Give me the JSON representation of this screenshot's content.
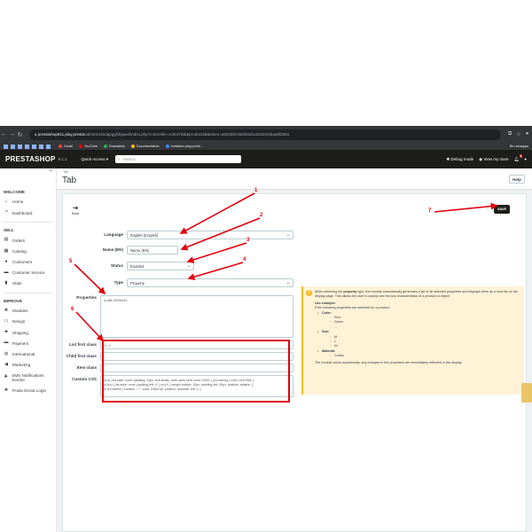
{
  "browser": {
    "url_host": "prestashop811.play.presta",
    "url_rest": "/admin140xdqpgyjhbjqwd/index.php?controller=AdminTab&productab&token=a25408c454b63d1d181b04baa9f250a",
    "bookmarks": [
      "Gmail",
      "YouTube",
      "Dramatelly",
      "Documentation",
      "Invitation.play.pro/le..."
    ],
    "bookmarks_right": "Bm seaapps"
  },
  "header": {
    "logo": "PRESTASHOP",
    "version": "8.1.1",
    "quick_access": "Quick Access ▾",
    "search_placeholder": "Search",
    "debug_mode": "Debug mode",
    "view_store": "View my store",
    "notif_count": "2"
  },
  "sidebar": {
    "welcome": "WELCOME",
    "welcome_items": [
      {
        "label": "Home",
        "icon": "home-icon"
      },
      {
        "label": "Dashboard",
        "icon": "trending-icon"
      }
    ],
    "sell": "SELL",
    "sell_items": [
      {
        "label": "Orders",
        "icon": "inbox-icon"
      },
      {
        "label": "Catalog",
        "icon": "store-icon"
      },
      {
        "label": "Customers",
        "icon": "account-icon"
      },
      {
        "label": "Customer Service",
        "icon": "chat-icon"
      },
      {
        "label": "Stats",
        "icon": "chart-icon"
      }
    ],
    "improve": "IMPROVE",
    "improve_items": [
      {
        "label": "Modules",
        "icon": "puzzle-icon"
      },
      {
        "label": "Design",
        "icon": "desktop-icon"
      },
      {
        "label": "Shipping",
        "icon": "truck-icon"
      },
      {
        "label": "Payment",
        "icon": "card-icon"
      },
      {
        "label": "International",
        "icon": "globe-icon"
      },
      {
        "label": "Marketing",
        "icon": "megaphone-icon"
      },
      {
        "label": "SMS Notifications Sender",
        "icon": "puzzle-icon"
      },
      {
        "label": "Posta Social Login",
        "icon": "puzzle-icon"
      }
    ]
  },
  "page": {
    "breadcrumb": "Tab",
    "title": "Tab",
    "help": "Help",
    "back": "Back",
    "save": "SAVE"
  },
  "form": {
    "language_label": "Language",
    "language_value": "English (English)",
    "name_label": "Name (EN)",
    "name_value": "Name (EN)",
    "status_label": "Status",
    "status_value": "Enabled",
    "type_label": "Type",
    "type_value": "Property",
    "properties_label": "Properties",
    "properties_value": "id-dfle-23234444",
    "list_first_label": "List first class",
    "list_first_value": "ul.ul",
    "child_first_label": "Child first class",
    "child_first_value": "",
    "item_label": "Item class",
    "item_value": "",
    "css_label": "Custom CSS",
    "css_lines": [
      "ul.ul { list-style: none; padding: 10px; font-family: arial, sans-serif; color: #333; } ul.ul strong { color: #1a73e8; }",
      "ul.ul ul { list-style: none; padding-left: 0; } ul.ul li { margin-bottom: 10px; padding-left: 20px; position: relative; }",
      "ul.ul li:before { content: \"✓\"; color: #28a745; position: absolute; left: 0; }"
    ]
  },
  "info": {
    "p1_pre": "When selecting the ",
    "p1_bold": "property",
    "p1_post": " type, the module automatically generates a list of all selected properties and displays them as a neat list on the display page. This allows the user to quickly see the key characteristics of a product or object.",
    "example_title": "Use example:",
    "example_intro": "If the following properties are selected for a product:",
    "groups": [
      {
        "name": "Color:",
        "values": [
          "Red",
          "Green",
          "..."
        ]
      },
      {
        "name": "Size:",
        "values": [
          "M",
          "L",
          "XL"
        ]
      },
      {
        "name": "Material:",
        "values": [
          "Cotton"
        ]
      }
    ],
    "footer": "The module works dynamically: any changes in the properties are immediately reflected in the display."
  },
  "annotations": {
    "numbers": [
      "1",
      "2",
      "3",
      "4",
      "5",
      "6",
      "7"
    ],
    "color": "#e2000f"
  }
}
